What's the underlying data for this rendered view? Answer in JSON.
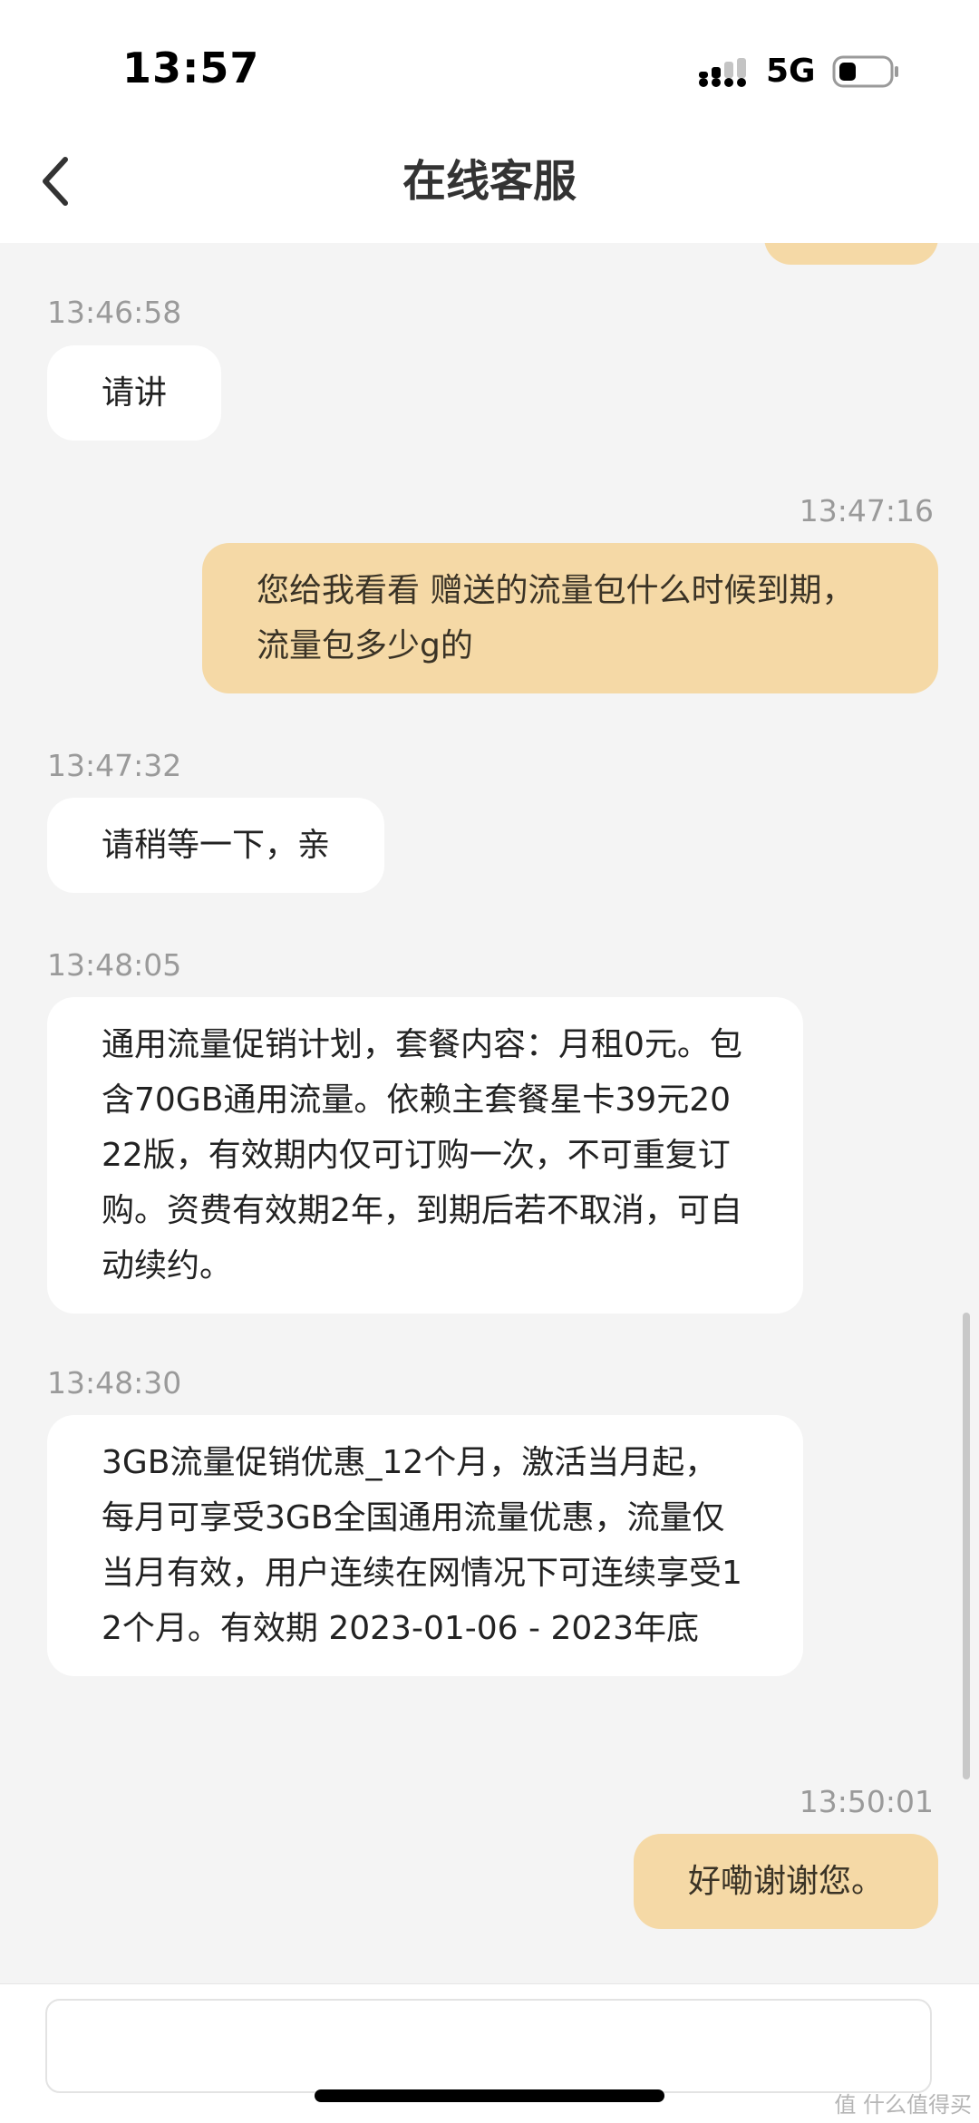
{
  "status_bar": {
    "time": "13:57",
    "network": "5G"
  },
  "header": {
    "title": "在线客服",
    "back_icon": "chevron-left-icon"
  },
  "messages": [
    {
      "sender": "service",
      "time": "13:46:58",
      "text": "请讲"
    },
    {
      "sender": "user",
      "time": "13:47:16",
      "text": "您给我看看 赠送的流量包什么时候到期，流量包多少g的"
    },
    {
      "sender": "service",
      "time": "13:47:32",
      "text": "请稍等一下，亲"
    },
    {
      "sender": "service",
      "time": "13:48:05",
      "text": "通用流量促销计划，套餐内容：月租0元。包含70GB通用流量。依赖主套餐星卡39元2022版，有效期内仅可订购一次，不可重复订购。资费有效期2年，到期后若不取消，可自动续约。"
    },
    {
      "sender": "service",
      "time": "13:48:30",
      "text": "3GB流量促销优惠_12个月，激活当月起，每月可享受3GB全国通用流量优惠，流量仅当月有效，用户连续在网情况下可连续享受12个月。有效期 2023-01-06 - 2023年底"
    },
    {
      "sender": "user",
      "time": "13:50:01",
      "text": "好嘞谢谢您。"
    }
  ],
  "input": {
    "value": "",
    "placeholder": ""
  },
  "watermark": "值 什么值得买",
  "colors": {
    "user_bubble": "#f5d9a6",
    "service_bubble": "#ffffff",
    "background": "#f4f4f4"
  }
}
